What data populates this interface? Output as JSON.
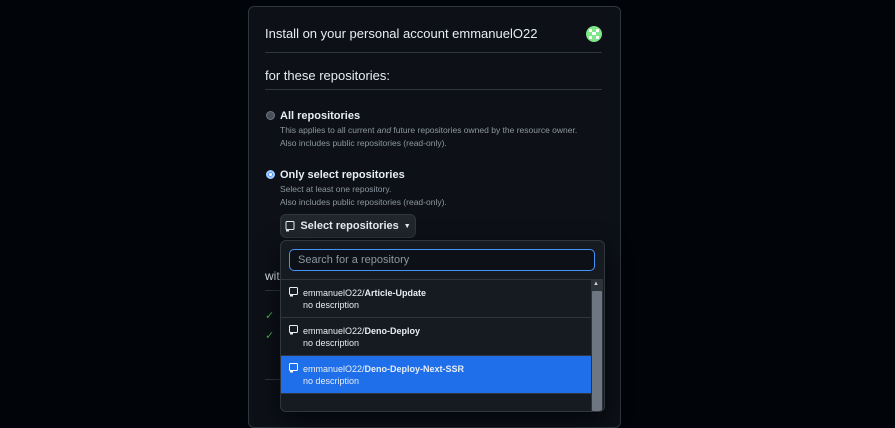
{
  "install": {
    "title": "Install on your personal account emmanuelO22"
  },
  "repositories_section": {
    "heading": "for these repositories:",
    "options": [
      {
        "title": "All repositories",
        "desc_line1_pre": "This applies to all current ",
        "desc_line1_em": "and",
        "desc_line1_post": " future repositories owned by the resource owner.",
        "desc_line2": "Also includes public repositories (read-only).",
        "selected": false
      },
      {
        "title": "Only select repositories",
        "desc_line1": "Select at least one repository.",
        "desc_line2": "Also includes public repositories (read-only).",
        "selected": true
      }
    ],
    "select_button_label": "Select repositories"
  },
  "permissions_partial": {
    "heading_fragment": "wit"
  },
  "dropdown": {
    "search_placeholder": "Search for a repository",
    "repos": [
      {
        "owner": "emmanuelO22/",
        "name": "Article-Update",
        "description": "no description",
        "selected": false
      },
      {
        "owner": "emmanuelO22/",
        "name": "Deno-Deploy",
        "description": "no description",
        "selected": false
      },
      {
        "owner": "emmanuelO22/",
        "name": "Deno-Deploy-Next-SSR",
        "description": "no description",
        "selected": true
      }
    ]
  },
  "colors": {
    "accent": "#1f6feb",
    "success": "#3fb950",
    "background": "#0d1117"
  }
}
